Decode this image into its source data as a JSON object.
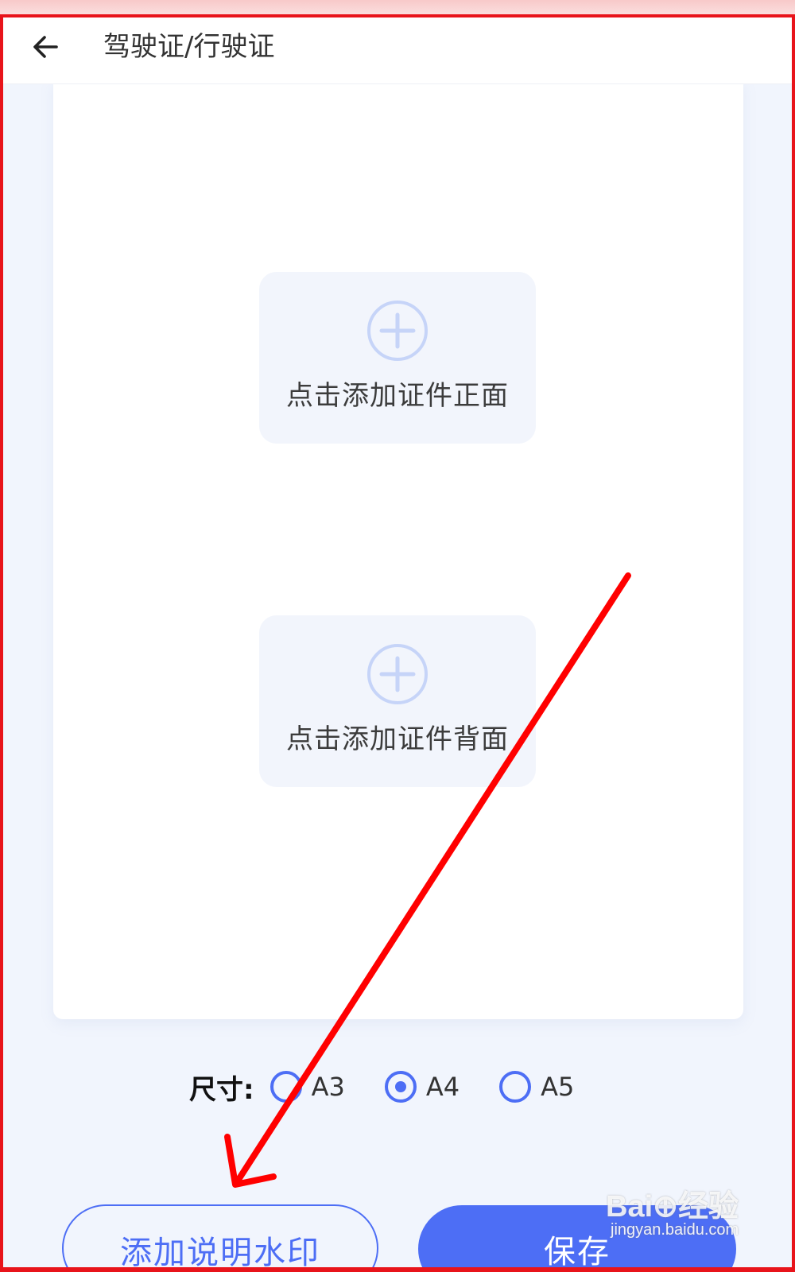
{
  "header": {
    "title": "驾驶证/行驶证",
    "back_icon": "arrow-left-icon"
  },
  "uploads": {
    "front_label": "点击添加证件正面",
    "back_label": "点击添加证件背面",
    "icon": "plus-circle-icon"
  },
  "size": {
    "label": "尺寸:",
    "options": [
      {
        "label": "A3",
        "checked": false
      },
      {
        "label": "A4",
        "checked": true
      },
      {
        "label": "A5",
        "checked": false
      }
    ]
  },
  "buttons": {
    "watermark_label": "添加说明水印",
    "save_label": "保存"
  },
  "watermark": {
    "logo_text": "Bai⊕经验",
    "url_text": "jingyan.baidu.com"
  },
  "colors": {
    "accent": "#4d6ef5",
    "annotation": "#ff0000",
    "frame": "#e8141b"
  }
}
